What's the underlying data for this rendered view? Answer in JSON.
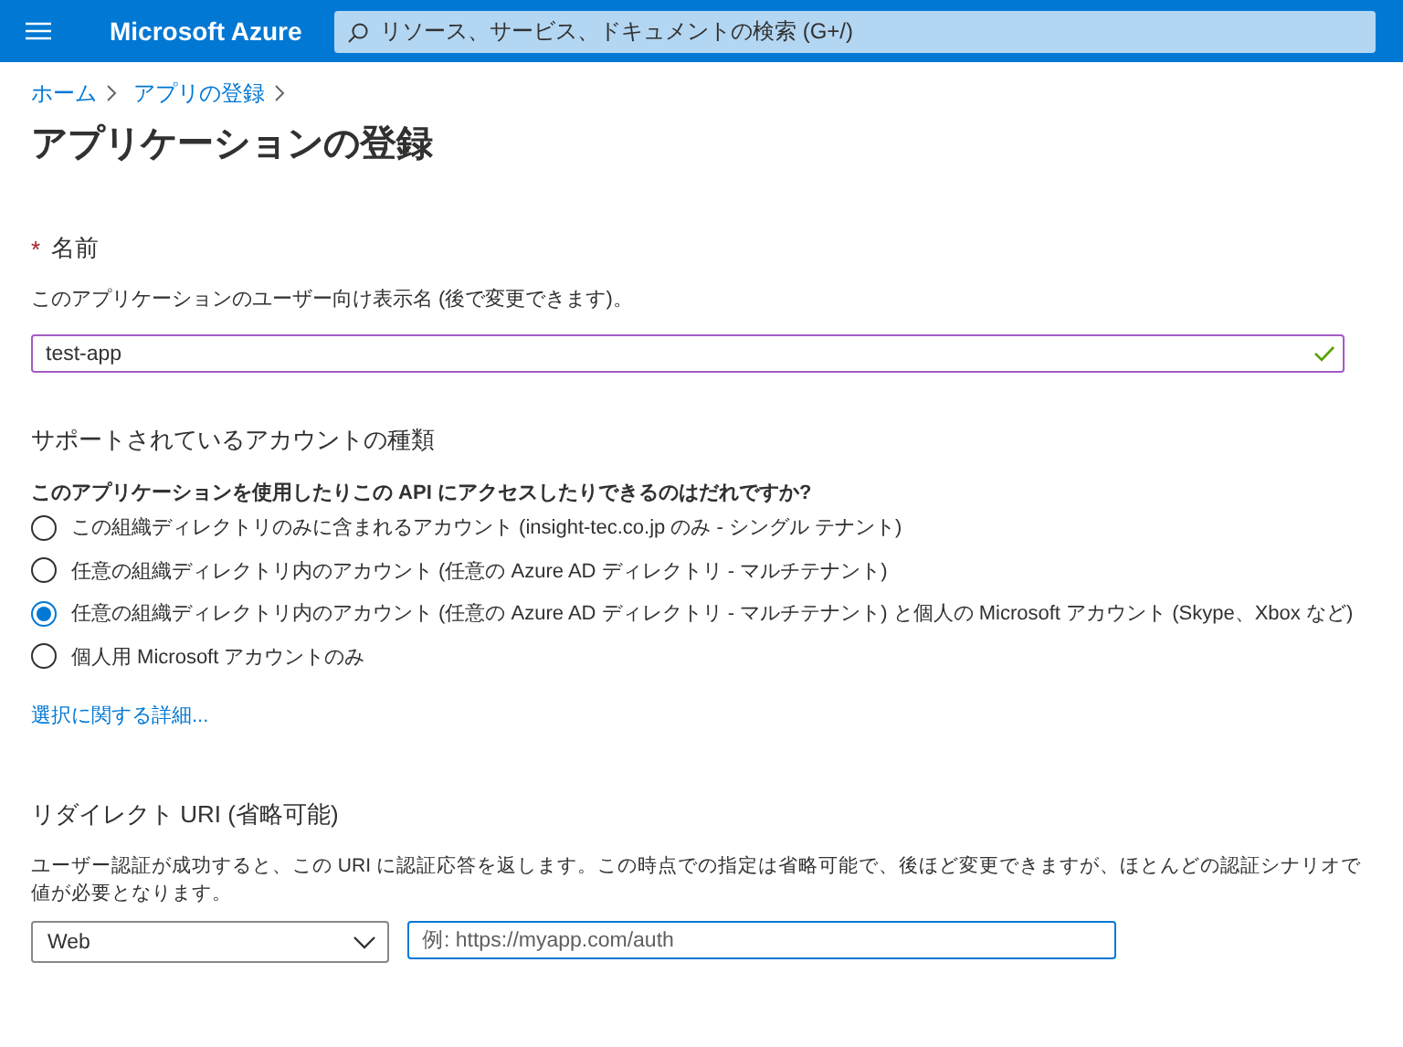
{
  "header": {
    "brand": "Microsoft Azure",
    "search": {
      "placeholder": "リソース、サービス、ドキュメントの検索 (G+/)"
    }
  },
  "breadcrumb": [
    "ホーム",
    "アプリの登録"
  ],
  "title": "アプリケーションの登録",
  "name_section": {
    "required_mark": "*",
    "label": "名前",
    "description": "このアプリケーションのユーザー向け表示名 (後で変更できます)。",
    "value": "test-app",
    "valid": true
  },
  "account_section": {
    "heading": "サポートされているアカウントの種類",
    "question": "このアプリケーションを使用したりこの API にアクセスしたりできるのはだれですか?",
    "options": [
      {
        "label": "この組織ディレクトリのみに含まれるアカウント (insight-tec.co.jp のみ - シングル テナント)",
        "selected": false
      },
      {
        "label": "任意の組織ディレクトリ内のアカウント (任意の Azure AD ディレクトリ - マルチテナント)",
        "selected": false
      },
      {
        "label": "任意の組織ディレクトリ内のアカウント (任意の Azure AD ディレクトリ - マルチテナント) と個人の Microsoft アカウント (Skype、Xbox など)",
        "selected": true
      },
      {
        "label": "個人用 Microsoft アカウントのみ",
        "selected": false
      }
    ],
    "link": "選択に関する詳細..."
  },
  "redirect_section": {
    "heading": "リダイレクト URI (省略可能)",
    "description": "ユーザー認証が成功すると、この URI に認証応答を返します。この時点での指定は省略可能で、後ほど変更できますが、ほとんどの認証シナリオで値が必要となります。",
    "platform": "Web",
    "uri_placeholder": "例: https://myapp.com/auth"
  }
}
